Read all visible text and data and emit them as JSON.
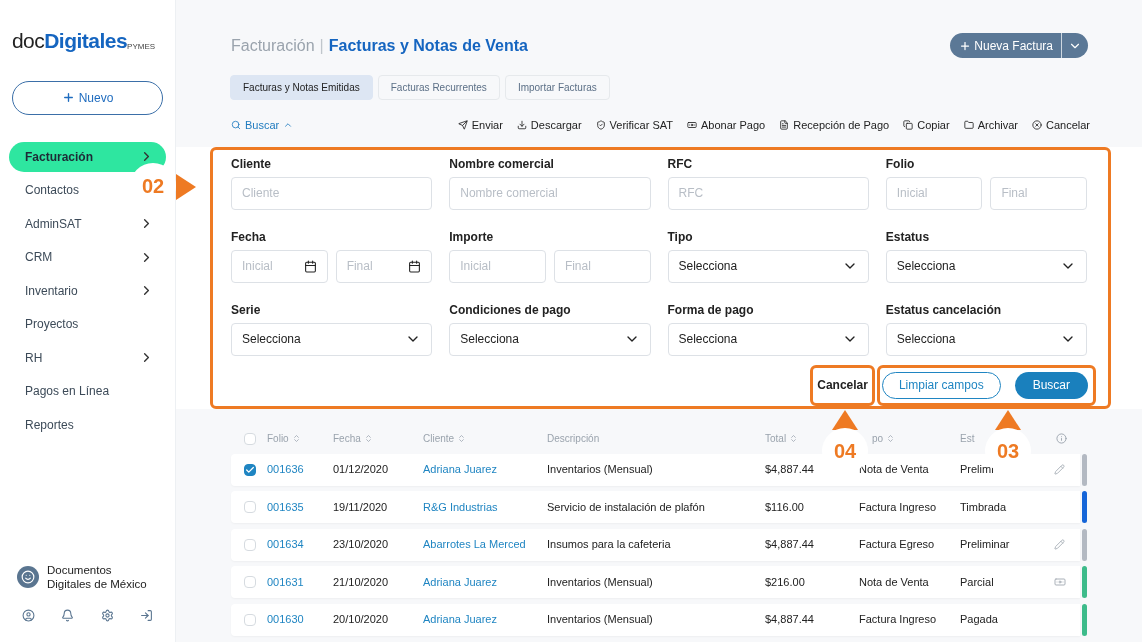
{
  "logo": {
    "prefix": "doc",
    "main": "Digitales",
    "suffix": "PYMES"
  },
  "new_button": {
    "label": "Nuevo"
  },
  "sidebar": {
    "items": [
      {
        "label": "Facturación",
        "selected": true,
        "has_arrow": true
      },
      {
        "label": "Contactos",
        "selected": false,
        "has_arrow": false
      },
      {
        "label": "AdminSAT",
        "selected": false,
        "has_arrow": true
      },
      {
        "label": "CRM",
        "selected": false,
        "has_arrow": true
      },
      {
        "label": "Inventario",
        "selected": false,
        "has_arrow": true
      },
      {
        "label": "Proyectos",
        "selected": false,
        "has_arrow": false
      },
      {
        "label": "RH",
        "selected": false,
        "has_arrow": true
      },
      {
        "label": "Pagos en Línea",
        "selected": false,
        "has_arrow": false
      },
      {
        "label": "Reportes",
        "selected": false,
        "has_arrow": false
      }
    ],
    "company": "Documentos Digitales de México"
  },
  "header": {
    "section": "Facturación",
    "separator": "|",
    "title": "Facturas y Notas de Venta"
  },
  "primary_button": {
    "label": "Nueva Factura"
  },
  "tabs": [
    {
      "label": "Facturas y Notas Emitidas",
      "selected": true
    },
    {
      "label": "Facturas Recurrentes",
      "selected": false
    },
    {
      "label": "Importar Facturas",
      "selected": false
    }
  ],
  "toolbar": {
    "search_toggle": "Buscar",
    "actions": [
      {
        "kind": "send",
        "label": "Enviar"
      },
      {
        "kind": "download",
        "label": "Descargar"
      },
      {
        "kind": "verify",
        "label": "Verificar SAT"
      },
      {
        "kind": "payment",
        "label": "Abonar Pago"
      },
      {
        "kind": "receipt",
        "label": "Recepción de Pago"
      },
      {
        "kind": "copy",
        "label": "Copiar"
      },
      {
        "kind": "archive",
        "label": "Archivar"
      },
      {
        "kind": "cancel",
        "label": "Cancelar"
      }
    ]
  },
  "filters": [
    {
      "kind": "text",
      "label": "Cliente",
      "placeholder": "Cliente"
    },
    {
      "kind": "text",
      "label": "Nombre comercial",
      "placeholder": "Nombre comercial"
    },
    {
      "kind": "text",
      "label": "RFC",
      "placeholder": "RFC"
    },
    {
      "kind": "range",
      "label": "Folio",
      "placeholders": [
        "Inicial",
        "Final"
      ]
    },
    {
      "kind": "date_range",
      "label": "Fecha",
      "placeholders": [
        "Inicial",
        "Final"
      ]
    },
    {
      "kind": "range",
      "label": "Importe",
      "placeholders": [
        "Inicial",
        "Final"
      ]
    },
    {
      "kind": "select",
      "label": "Tipo",
      "value": "Selecciona"
    },
    {
      "kind": "select",
      "label": "Estatus",
      "value": "Selecciona"
    },
    {
      "kind": "select",
      "label": "Serie",
      "value": "Selecciona"
    },
    {
      "kind": "select",
      "label": "Condiciones de pago",
      "value": "Selecciona"
    },
    {
      "kind": "select",
      "label": "Forma de pago",
      "value": "Selecciona"
    },
    {
      "kind": "select",
      "label": "Estatus cancelación",
      "value": "Selecciona"
    }
  ],
  "filter_actions": {
    "cancel": "Cancelar",
    "clear": "Limpiar campos",
    "search": "Buscar"
  },
  "table": {
    "select_all_checked": false,
    "columns": [
      {
        "label": "Folio",
        "sortable": true
      },
      {
        "label": "Fecha",
        "sortable": true
      },
      {
        "label": "Cliente",
        "sortable": true
      },
      {
        "label": "Descripción",
        "sortable": false
      },
      {
        "label": "Total",
        "sortable": true
      },
      {
        "label": "po",
        "sortable": true
      },
      {
        "label": "Est",
        "sortable": false
      }
    ],
    "rows": [
      {
        "checked": true,
        "folio": "001636",
        "fecha": "01/12/2020",
        "cliente": "Adriana Juarez",
        "descripcion": "Inventarios (Mensual)",
        "total": "$4,887.44",
        "tipo": "Nota de Venta",
        "estatus": "Prelimi",
        "kind": "edit",
        "color": "#b3b9c2"
      },
      {
        "checked": false,
        "folio": "001635",
        "fecha": "19/11/2020",
        "cliente": "R&G Industrias",
        "descripcion": "Servicio de instalación de plafón",
        "total": "$116.00",
        "tipo": "Factura Ingreso",
        "estatus": "Timbrada",
        "kind": "plain",
        "color": "#1565d8"
      },
      {
        "checked": false,
        "folio": "001634",
        "fecha": "23/10/2020",
        "cliente": "Abarrotes La Merced",
        "descripcion": "Insumos para la cafeteria",
        "total": "$4,887.44",
        "tipo": "Factura Egreso",
        "estatus": "Preliminar",
        "kind": "edit",
        "color": "#b3b9c2"
      },
      {
        "checked": false,
        "folio": "001631",
        "fecha": "21/10/2020",
        "cliente": "Adriana Juarez",
        "descripcion": "Inventarios (Mensual)",
        "total": "$216.00",
        "tipo": "Nota de Venta",
        "estatus": "Parcial",
        "kind": "payment",
        "color": "#3dbb8a"
      },
      {
        "checked": false,
        "folio": "001630",
        "fecha": "20/10/2020",
        "cliente": "Adriana Juarez",
        "descripcion": "Inventarios (Mensual)",
        "total": "$4,887.44",
        "tipo": "Factura Ingreso",
        "estatus": "Pagada",
        "kind": "plain",
        "color": "#3dbb8a"
      }
    ]
  },
  "callouts": [
    {
      "label": "02"
    },
    {
      "label": "04"
    },
    {
      "label": "03"
    }
  ]
}
